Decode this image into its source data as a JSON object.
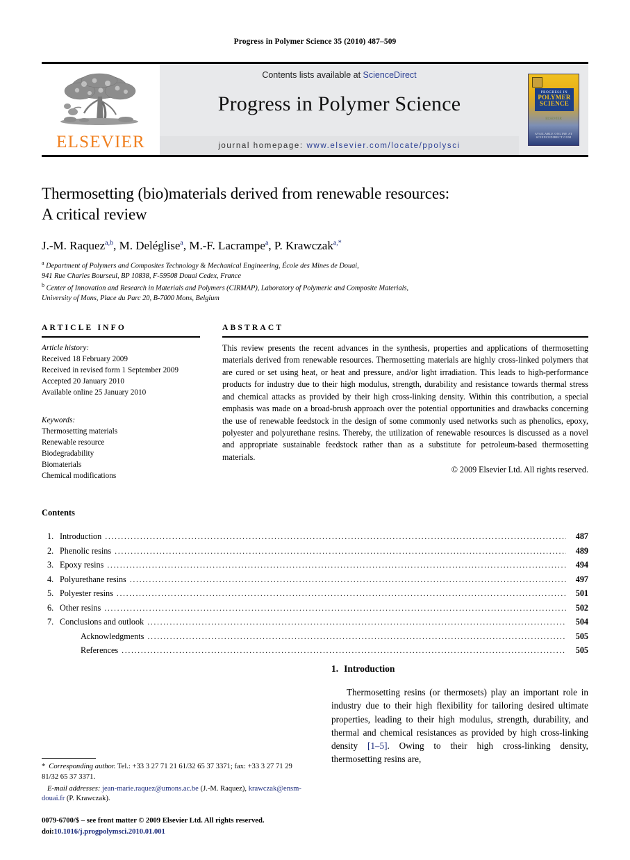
{
  "running_head": "Progress in Polymer Science 35 (2010) 487–509",
  "masthead": {
    "contents_prefix": "Contents lists available at ",
    "sciencedirect": "ScienceDirect",
    "journal_title": "Progress in Polymer Science",
    "homepage_label": "journal homepage:",
    "homepage_url": "www.elsevier.com/locate/ppolysci",
    "publisher_wordmark": "ELSEVIER",
    "cover": {
      "line1": "PROGRESS IN",
      "line2": "POLYMER",
      "line3": "SCIENCE",
      "mid_text": "ELSEVIER",
      "bottom_text": "AVAILABLE ONLINE AT SCIENCEDIRECT.COM"
    }
  },
  "article": {
    "title_line1": "Thermosetting (bio)materials derived from renewable resources:",
    "title_line2": "A critical review",
    "authors": [
      {
        "name": "J.-M. Raquez",
        "marks": "a,b",
        "sep": ", "
      },
      {
        "name": "M. Deléglise",
        "marks": "a",
        "sep": ", "
      },
      {
        "name": "M.-F. Lacrampe",
        "marks": "a",
        "sep": ", "
      },
      {
        "name": "P. Krawczak",
        "marks": "a,*",
        "sep": ""
      }
    ],
    "affiliations": [
      {
        "mark": "a",
        "line1": "Department of Polymers and Composites Technology & Mechanical Engineering, École des Mines de Douai,",
        "line2": "941 Rue Charles Bourseul, BP 10838, F-59508 Douai Cedex, France"
      },
      {
        "mark": "b",
        "line1": "Center of Innovation and Research in Materials and Polymers (CIRMAP), Laboratory of Polymeric and Composite Materials,",
        "line2": "University of Mons, Place du Parc 20, B-7000 Mons, Belgium"
      }
    ]
  },
  "article_info": {
    "heading": "ARTICLE INFO",
    "history_label": "Article history:",
    "history": [
      "Received 18 February 2009",
      "Received in revised form 1 September 2009",
      "Accepted 20 January 2010",
      "Available online 25 January 2010"
    ],
    "keywords_label": "Keywords:",
    "keywords": [
      "Thermosetting materials",
      "Renewable resource",
      "Biodegradability",
      "Biomaterials",
      "Chemical modifications"
    ]
  },
  "abstract": {
    "heading": "ABSTRACT",
    "text": "This review presents the recent advances in the synthesis, properties and applications of thermosetting materials derived from renewable resources. Thermosetting materials are highly cross-linked polymers that are cured or set using heat, or heat and pressure, and/or light irradiation. This leads to high-performance products for industry due to their high modulus, strength, durability and resistance towards thermal stress and chemical attacks as provided by their high cross-linking density. Within this contribution, a special emphasis was made on a broad-brush approach over the potential opportunities and drawbacks concerning the use of renewable feedstock in the design of some commonly used networks such as phenolics, epoxy, polyester and polyurethane resins. Thereby, the utilization of renewable resources is discussed as a novel and appropriate sustainable feedstock rather than as a substitute for petroleum-based thermosetting materials.",
    "copyright": "© 2009 Elsevier Ltd. All rights reserved."
  },
  "contents": {
    "heading": "Contents",
    "entries": [
      {
        "num": "1.",
        "label": "Introduction",
        "page": "487",
        "indent": false
      },
      {
        "num": "2.",
        "label": "Phenolic resins",
        "page": "489",
        "indent": false
      },
      {
        "num": "3.",
        "label": "Epoxy resins",
        "page": "494",
        "indent": false
      },
      {
        "num": "4.",
        "label": "Polyurethane resins",
        "page": "497",
        "indent": false
      },
      {
        "num": "5.",
        "label": "Polyester resins",
        "page": "501",
        "indent": false
      },
      {
        "num": "6.",
        "label": "Other resins",
        "page": "502",
        "indent": false
      },
      {
        "num": "7.",
        "label": "Conclusions and outlook",
        "page": "504",
        "indent": false
      },
      {
        "num": "",
        "label": "Acknowledgments",
        "page": "505",
        "indent": true
      },
      {
        "num": "",
        "label": "References",
        "page": "505",
        "indent": true
      }
    ]
  },
  "introduction": {
    "number": "1.",
    "heading": "Introduction",
    "paragraph_part1": "Thermosetting resins (or thermosets) play an important role in industry due to their high flexibility for tailoring desired ultimate properties, leading to their high modulus, strength, durability, and thermal and chemical resistances as provided by high cross-linking density ",
    "citation": "[1–5]",
    "paragraph_part2": ". Owing to their high cross-linking density, thermosetting resins are,"
  },
  "footnotes": {
    "corresponding_star": "*",
    "corresponding_label": "Corresponding author.",
    "corresponding_tel": " Tel.: +33 3 27 71 21 61/32 65 37 3371;",
    "corresponding_fax": "fax: +33 3 27 71 29 81/32 65 37 3371.",
    "email_label": "E-mail addresses:",
    "email1": "jean-marie.raquez@umons.ac.be",
    "email1_owner": "(J.-M. Raquez)",
    "email2": "krawczak@ensm-douai.fr",
    "email2_owner": "(P. Krawczak)",
    "imprint_line": "0079-6700/$ – see front matter © 2009 Elsevier Ltd. All rights reserved.",
    "doi_label": "doi:",
    "doi_value": "10.1016/j.progpolymsci.2010.01.001"
  }
}
